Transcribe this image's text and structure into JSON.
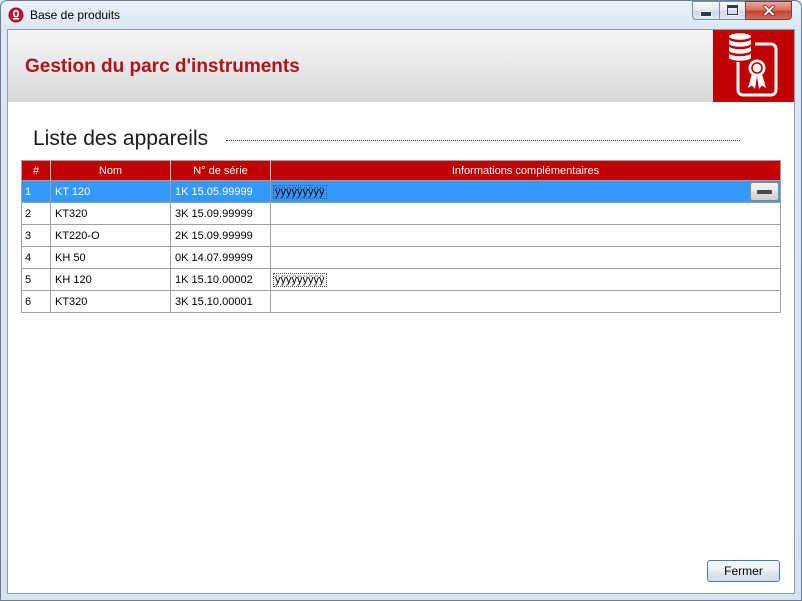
{
  "window": {
    "title": "Base de produits",
    "app_icon": "app-logo-icon",
    "controls": {
      "minimize_icon": "minimize-icon",
      "maximize_icon": "maximize-icon",
      "close_icon": "close-icon"
    }
  },
  "header": {
    "title": "Gestion du parc d'instruments",
    "logo_icon": "certificate-database-icon"
  },
  "section": {
    "title": "Liste des appareils"
  },
  "table": {
    "columns": {
      "num": "#",
      "nom": "Nom",
      "serie": "N° de série",
      "info": "Informations complémentaires"
    },
    "selected_row": 0,
    "row_action_icon": "dash-icon",
    "rows": [
      {
        "num": "1",
        "nom": "KT 120",
        "serie": "1K 15.05.99999",
        "info": "ÿÿÿÿÿÿÿÿÿ"
      },
      {
        "num": "2",
        "nom": "KT320",
        "serie": "3K 15.09.99999",
        "info": ""
      },
      {
        "num": "3",
        "nom": "KT220-O",
        "serie": "2K 15.09.99999",
        "info": ""
      },
      {
        "num": "4",
        "nom": "KH 50",
        "serie": "0K 14.07.99999",
        "info": ""
      },
      {
        "num": "5",
        "nom": "KH 120",
        "serie": "1K 15.10.00002",
        "info": "ÿÿÿÿÿÿÿÿÿ"
      },
      {
        "num": "6",
        "nom": "KT320",
        "serie": "3K 15.10.00001",
        "info": ""
      }
    ]
  },
  "footer": {
    "close_label": "Fermer"
  },
  "colors": {
    "brand_red": "#c00000",
    "title_red": "#b4121b",
    "selection_blue": "#3399ff"
  }
}
